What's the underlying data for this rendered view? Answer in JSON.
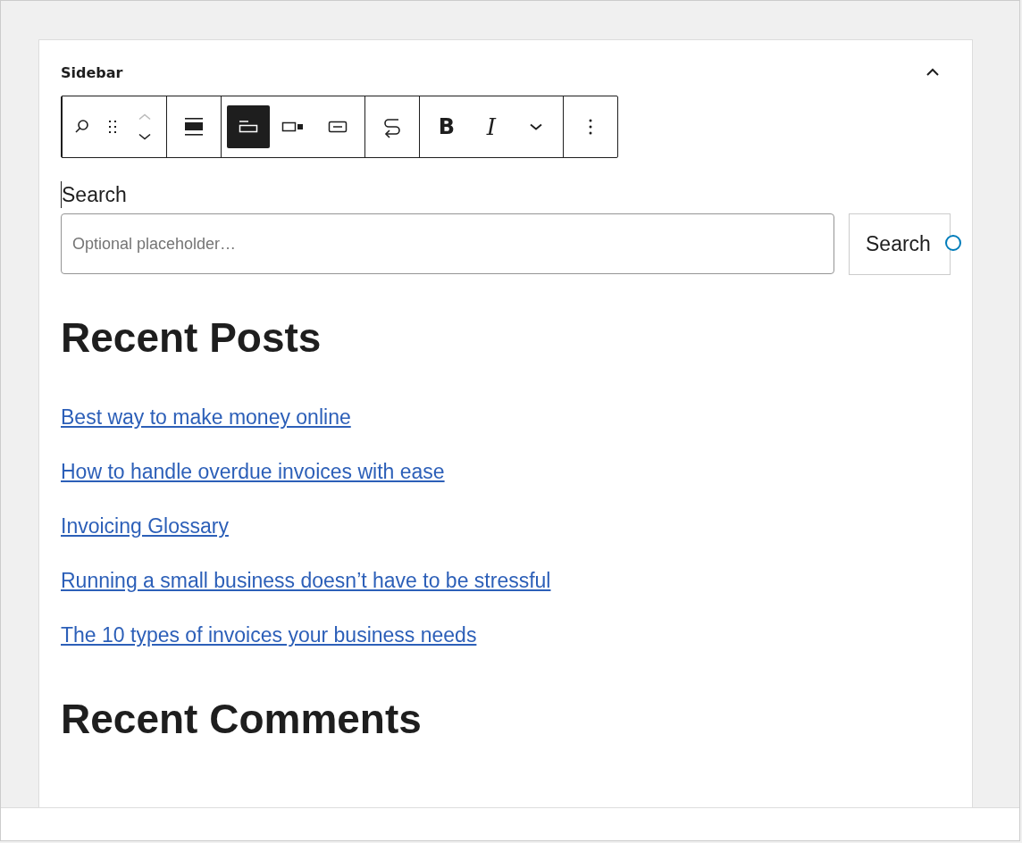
{
  "panel": {
    "title": "Sidebar",
    "collapse_expanded": true
  },
  "toolbar": {
    "groups": [
      {
        "buttons": [
          {
            "kind": "search",
            "selected": false
          },
          {
            "kind": "drag",
            "selected": false
          },
          {
            "kind": "move-up",
            "selected": false,
            "disabled": true
          },
          {
            "kind": "move-down",
            "selected": false,
            "disabled": false
          }
        ]
      },
      {
        "buttons": [
          {
            "kind": "align",
            "selected": false
          }
        ]
      },
      {
        "buttons": [
          {
            "kind": "label-outside",
            "selected": true
          },
          {
            "kind": "button-inside",
            "selected": false
          },
          {
            "kind": "no-button",
            "selected": false
          }
        ]
      },
      {
        "buttons": [
          {
            "kind": "transform",
            "selected": false
          }
        ]
      },
      {
        "buttons": [
          {
            "kind": "bold",
            "text": "B",
            "selected": false
          },
          {
            "kind": "italic",
            "text": "I",
            "selected": false
          },
          {
            "kind": "more-format",
            "selected": false
          }
        ]
      },
      {
        "buttons": [
          {
            "kind": "options",
            "selected": false
          }
        ]
      }
    ]
  },
  "search": {
    "label": "Search",
    "placeholder": "Optional placeholder…",
    "button": "Search"
  },
  "recent_posts": {
    "heading": "Recent Posts",
    "links": [
      "Best way to make money online",
      "How to handle overdue invoices with ease",
      "Invoicing Glossary",
      "Running a small business doesn’t have to be stressful",
      "The 10 types of invoices your business needs"
    ]
  },
  "recent_comments": {
    "heading": "Recent Comments"
  }
}
